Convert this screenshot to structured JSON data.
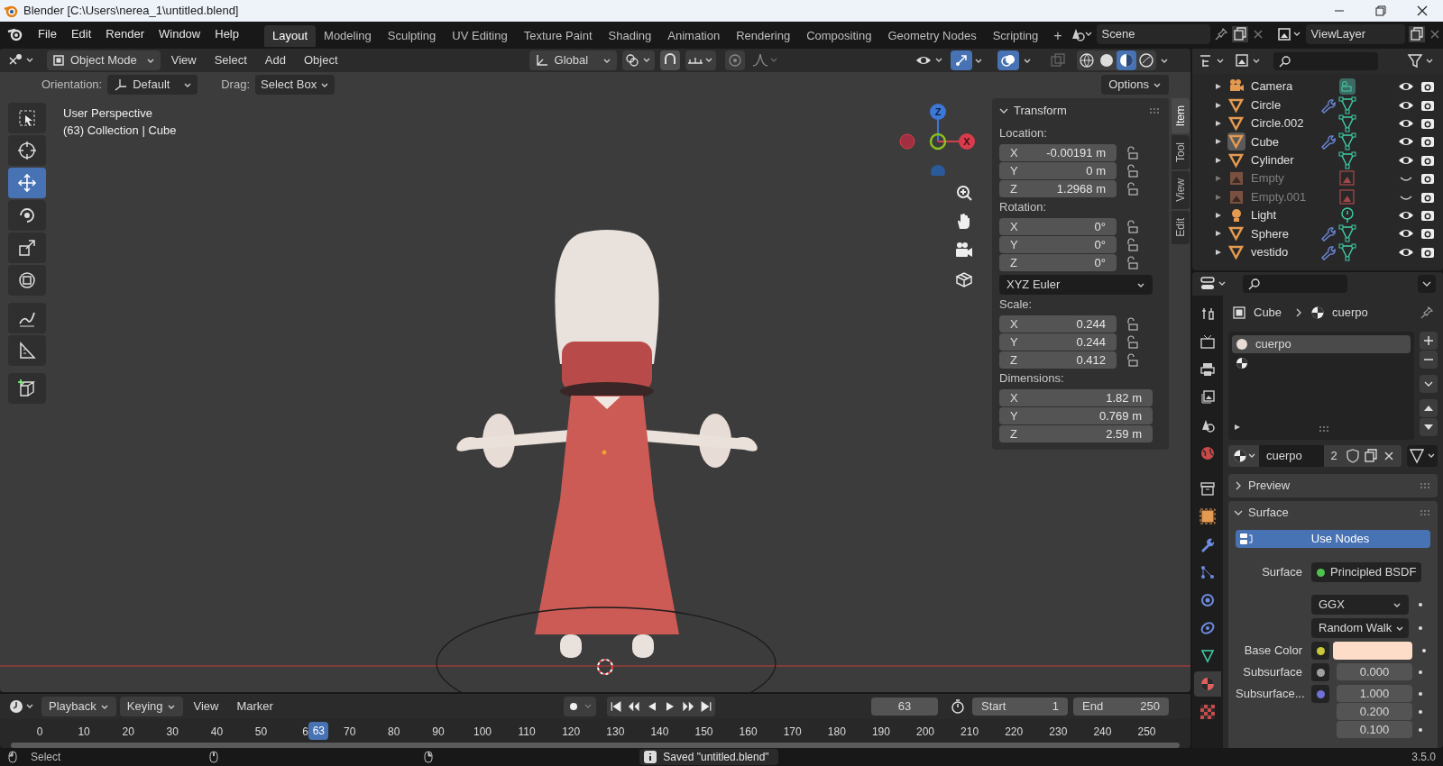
{
  "window": {
    "title": "Blender [C:\\Users\\nerea_1\\untitled.blend]"
  },
  "menu": [
    "File",
    "Edit",
    "Render",
    "Window",
    "Help"
  ],
  "workspaces": [
    {
      "label": "Layout",
      "selected": true
    },
    {
      "label": "Modeling",
      "selected": false
    },
    {
      "label": "Sculpting",
      "selected": false
    },
    {
      "label": "UV Editing",
      "selected": false
    },
    {
      "label": "Texture Paint",
      "selected": false
    },
    {
      "label": "Shading",
      "selected": false
    },
    {
      "label": "Animation",
      "selected": false
    },
    {
      "label": "Rendering",
      "selected": false
    },
    {
      "label": "Compositing",
      "selected": false
    },
    {
      "label": "Geometry Nodes",
      "selected": false
    },
    {
      "label": "Scripting",
      "selected": false
    }
  ],
  "add_workspace": "+",
  "scene": "Scene",
  "view_layer": "ViewLayer",
  "viewport_header": {
    "mode": "Object Mode",
    "menus": [
      "View",
      "Select",
      "Add",
      "Object"
    ],
    "orientation": "Global",
    "gizmos_on": true,
    "overlays_on": true,
    "shading": [
      {
        "kind": "wireframe",
        "selected": false
      },
      {
        "kind": "solid",
        "selected": false
      },
      {
        "kind": "material",
        "selected": true
      },
      {
        "kind": "rendered",
        "selected": false
      }
    ]
  },
  "tool_settings": {
    "orientation_label": "Orientation:",
    "orientation": "Default",
    "drag_label": "Drag:",
    "drag": "Select Box",
    "options": "Options"
  },
  "toolbar": [
    {
      "kind": "select",
      "selected": false
    },
    {
      "kind": "cursor",
      "selected": false
    },
    {
      "kind": "move",
      "selected": true
    },
    {
      "kind": "rotate",
      "selected": false
    },
    {
      "kind": "scale",
      "selected": false
    },
    {
      "kind": "transform",
      "selected": false
    },
    {
      "kind": "annotate",
      "selected": false
    },
    {
      "kind": "measure",
      "selected": false
    },
    {
      "kind": "add-cube",
      "selected": false
    }
  ],
  "viewport_info": [
    "User Perspective",
    "(63) Collection | Cube"
  ],
  "gizmo": {
    "z": "Z",
    "x": "X"
  },
  "sidebar": {
    "tabs": [
      {
        "label": "Item",
        "selected": true
      },
      {
        "label": "Tool",
        "selected": false
      },
      {
        "label": "View",
        "selected": false
      },
      {
        "label": "Edit",
        "selected": false
      }
    ],
    "panel": {
      "title": "Transform",
      "expanded": true
    },
    "groups": [
      {
        "label": "Location:",
        "fields": [
          {
            "axis": "X",
            "value": "-0.00191 m",
            "locked": false
          },
          {
            "axis": "Y",
            "value": "0 m",
            "locked": false
          },
          {
            "axis": "Z",
            "value": "1.2968 m",
            "locked": false
          }
        ]
      },
      {
        "label": "Rotation:",
        "fields": [
          {
            "axis": "X",
            "value": "0°",
            "locked": false
          },
          {
            "axis": "Y",
            "value": "0°",
            "locked": false
          },
          {
            "axis": "Z",
            "value": "0°",
            "locked": false
          }
        ],
        "mode": "XYZ Euler"
      },
      {
        "label": "Scale:",
        "fields": [
          {
            "axis": "X",
            "value": "0.244",
            "locked": false
          },
          {
            "axis": "Y",
            "value": "0.244",
            "locked": false
          },
          {
            "axis": "Z",
            "value": "0.412",
            "locked": false
          }
        ]
      },
      {
        "label": "Dimensions:",
        "fields": [
          {
            "axis": "X",
            "value": "1.82 m"
          },
          {
            "axis": "Y",
            "value": "0.769 m"
          },
          {
            "axis": "Z",
            "value": "2.59 m"
          }
        ]
      }
    ]
  },
  "outliner": {
    "items": [
      {
        "name": "Camera",
        "kind": "camera",
        "modifier": false,
        "active": false,
        "disabled": false,
        "visible": true
      },
      {
        "name": "Circle",
        "kind": "mesh",
        "modifier": true,
        "active": false,
        "disabled": false,
        "visible": true
      },
      {
        "name": "Circle.002",
        "kind": "mesh",
        "modifier": false,
        "active": false,
        "disabled": false,
        "visible": true
      },
      {
        "name": "Cube",
        "kind": "mesh",
        "modifier": true,
        "active": true,
        "disabled": false,
        "visible": true
      },
      {
        "name": "Cylinder",
        "kind": "mesh",
        "modifier": false,
        "active": false,
        "disabled": false,
        "visible": true
      },
      {
        "name": "Empty",
        "kind": "empty",
        "modifier": false,
        "active": false,
        "disabled": true,
        "visible": false
      },
      {
        "name": "Empty.001",
        "kind": "empty",
        "modifier": false,
        "active": false,
        "disabled": true,
        "visible": false
      },
      {
        "name": "Light",
        "kind": "light",
        "modifier": false,
        "active": false,
        "disabled": false,
        "visible": true
      },
      {
        "name": "Sphere",
        "kind": "mesh",
        "modifier": true,
        "active": false,
        "disabled": false,
        "visible": true
      },
      {
        "name": "vestido",
        "kind": "mesh",
        "modifier": true,
        "active": false,
        "disabled": false,
        "visible": true
      }
    ]
  },
  "properties": {
    "tabs": [
      {
        "kind": "tool",
        "selected": false
      },
      {
        "kind": "render",
        "selected": false
      },
      {
        "kind": "output",
        "selected": false
      },
      {
        "kind": "view-layer",
        "selected": false
      },
      {
        "kind": "scene",
        "selected": false
      },
      {
        "kind": "world",
        "selected": false
      },
      {
        "kind": "collection",
        "selected": false
      },
      {
        "kind": "object",
        "selected": false
      },
      {
        "kind": "modifiers",
        "selected": false
      },
      {
        "kind": "particles",
        "selected": false
      },
      {
        "kind": "physics",
        "selected": false
      },
      {
        "kind": "constraints",
        "selected": false
      },
      {
        "kind": "data",
        "selected": false
      },
      {
        "kind": "material",
        "selected": true
      },
      {
        "kind": "texture",
        "selected": false
      }
    ],
    "breadcrumb": [
      "Cube",
      "cuerpo"
    ],
    "slots": [
      {
        "kind": "material",
        "name": "cuerpo",
        "selected": true
      },
      {
        "kind": "empty",
        "selected": false
      }
    ],
    "material": {
      "name": "cuerpo",
      "users": "2"
    },
    "panels": [
      {
        "title": "Preview",
        "expanded": false
      },
      {
        "title": "Surface",
        "expanded": true
      }
    ],
    "use_nodes": "Use Nodes",
    "rows": [
      {
        "kind": "socket",
        "label": "Surface",
        "value": "Principled BSDF",
        "color": "#4ec24e"
      },
      {
        "kind": "dropdown",
        "value": "GGX"
      },
      {
        "kind": "dropdown",
        "value": "Random Walk"
      },
      {
        "kind": "swatch",
        "label": "Base Color",
        "color": "#c8c83a",
        "swatch": {
          "color": "#fddcc8"
        }
      },
      {
        "kind": "number",
        "label": "Subsurface",
        "color": "#a0a0a0",
        "values": [
          "0.000"
        ]
      },
      {
        "kind": "number",
        "label": "Subsurface...",
        "color": "#7070d8",
        "values": [
          "1.000",
          "0.200",
          "0.100"
        ]
      }
    ]
  },
  "timeline": {
    "menus": [
      "Playback",
      "Keying",
      "View",
      "Marker"
    ],
    "frame": "63",
    "start_label": "Start",
    "start": "1",
    "end_label": "End",
    "end": "250",
    "ticks": [
      "0",
      "10",
      "20",
      "30",
      "40",
      "50",
      "6",
      "70",
      "80",
      "90",
      "100",
      "110",
      "120",
      "130",
      "140",
      "150",
      "160",
      "170",
      "180",
      "190",
      "200",
      "210",
      "220",
      "230",
      "240",
      "250"
    ],
    "current": "63"
  },
  "status": {
    "hint": "Select",
    "message": "Saved \"untitled.blend\"",
    "version": "3.5.0"
  }
}
